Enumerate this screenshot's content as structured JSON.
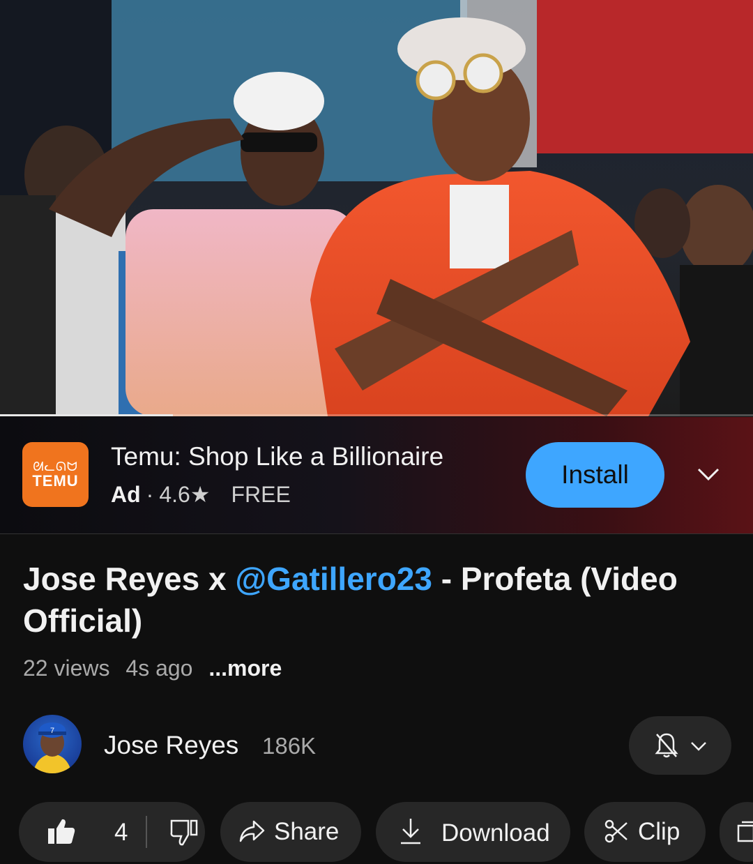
{
  "player": {
    "progress_fraction": 0.23
  },
  "ad": {
    "logo_glyphs": "ᘛᓚᘏᗢ",
    "logo_word": "TEMU",
    "title": "Temu: Shop Like a Billionaire",
    "label": "Ad",
    "separator": "·",
    "rating": "4.6★",
    "price": "FREE",
    "install_label": "Install",
    "brand_color": "#f0741e",
    "accent_color": "#3ea6ff"
  },
  "video": {
    "title_before": "Jose Reyes x ",
    "title_mention": "@Gatillero23",
    "title_after": "  - Profeta (Video Official)",
    "views": "22 views",
    "age": "4s ago",
    "more": "...more"
  },
  "channel": {
    "name": "Jose Reyes",
    "subscribers": "186K",
    "avatar_jersey_number": "7"
  },
  "actions": {
    "like_count": "4",
    "share_label": "Share",
    "download_label": "Download",
    "clip_label": "Clip"
  },
  "icons": {
    "like": "thumbs-up-icon",
    "dislike": "thumbs-down-icon",
    "share": "share-arrow-icon",
    "download": "download-icon",
    "clip": "scissors-icon",
    "save": "save-playlist-icon",
    "bell": "bell-off-icon",
    "chevron": "chevron-down-icon"
  }
}
